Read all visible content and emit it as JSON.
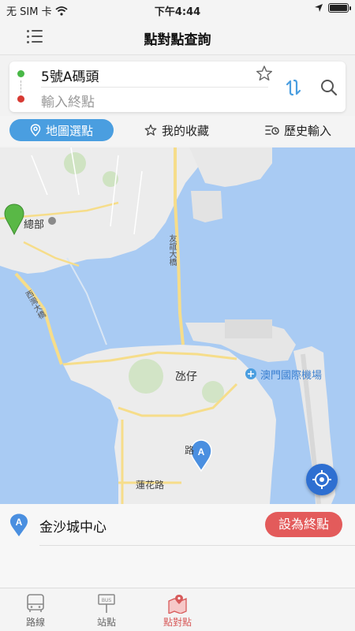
{
  "status_bar": {
    "carrier": "无 SIM 卡",
    "time": "下午4:44"
  },
  "header": {
    "title": "點對點查詢"
  },
  "search": {
    "start": "5號A碼頭",
    "end_placeholder": "輸入終點"
  },
  "tabs": [
    {
      "label": "地圖選點",
      "icon": "map-pin-icon",
      "active": true
    },
    {
      "label": "我的收藏",
      "icon": "star-icon",
      "active": false
    },
    {
      "label": "歷史輸入",
      "icon": "history-icon",
      "active": false
    }
  ],
  "map": {
    "labels": {
      "area1": "總部",
      "bridge1": "友誼大橋",
      "bridge2": "西灣大橋",
      "area2": "氹仔",
      "airport": "澳門國際機場",
      "road": "蓮花路",
      "road2": "路"
    },
    "colors": {
      "water": "#a9cbf3",
      "land": "#ececec",
      "road": "#f6dd8a"
    }
  },
  "selected_place": {
    "pin_letter": "A",
    "name": "金沙城中心",
    "action": "設為終點"
  },
  "tabbar": [
    {
      "label": "路線",
      "icon": "bus-icon",
      "active": false
    },
    {
      "label": "站點",
      "icon": "bus-stop-icon",
      "active": false
    },
    {
      "label": "點對點",
      "icon": "point-map-icon",
      "active": true
    }
  ]
}
